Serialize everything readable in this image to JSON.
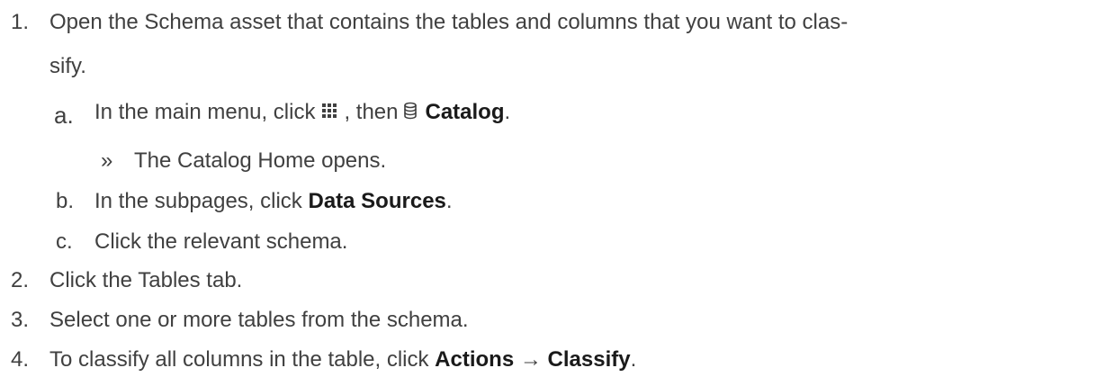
{
  "steps": [
    {
      "num": "1.",
      "text_line1": "Open the Schema asset that contains the tables and columns that you want to clas-",
      "text_line2": "sify.",
      "substeps": [
        {
          "letter": "a.",
          "prefix": "In the main menu, click",
          "icon1": "grid-icon",
          "middle": ", then",
          "icon2": "database-icon",
          "bold": "Catalog",
          "suffix": ".",
          "result_marker": "»",
          "result_text": "The Catalog Home opens."
        },
        {
          "letter": "b.",
          "prefix": "In the subpages, click",
          "bold": "Data Sources",
          "suffix": "."
        },
        {
          "letter": "c.",
          "prefix": "Click the relevant schema."
        }
      ]
    },
    {
      "num": "2.",
      "text": "Click the Tables tab."
    },
    {
      "num": "3.",
      "text": "Select one or more tables from the schema."
    },
    {
      "num": "4.",
      "prefix": "To classify all columns in the table, click",
      "bold1": "Actions",
      "arrow": "→",
      "bold2": "Classify",
      "suffix": "."
    }
  ]
}
